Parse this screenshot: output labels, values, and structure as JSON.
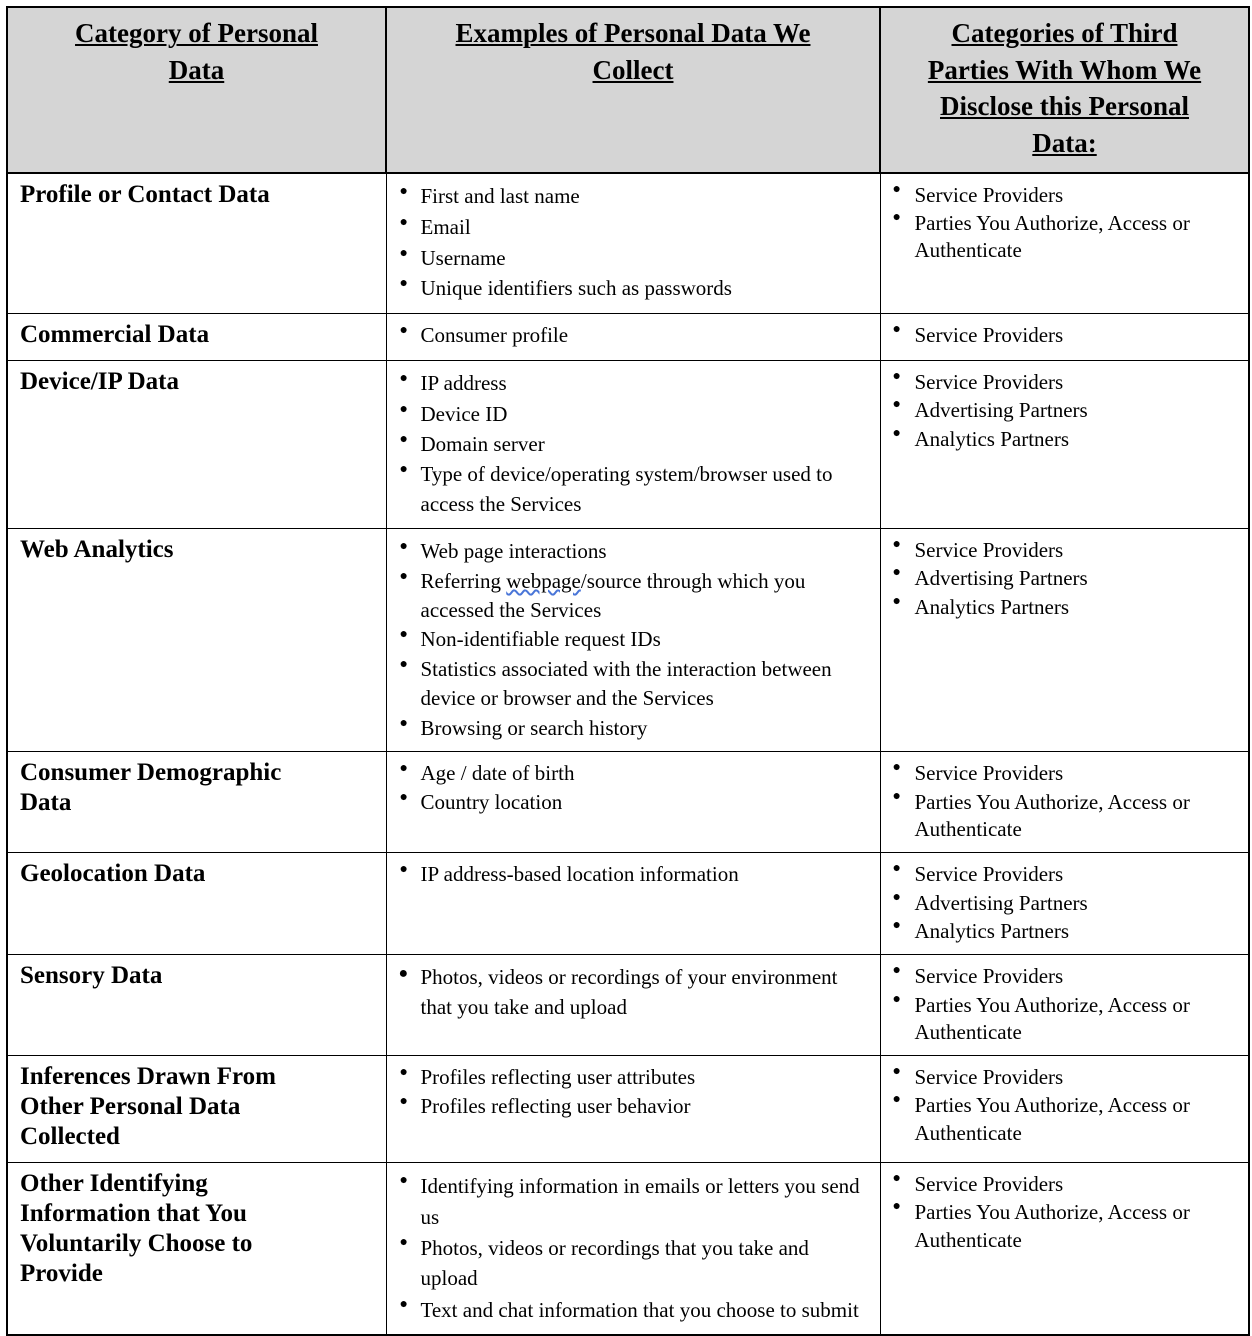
{
  "document": {
    "type": "privacy-policy-data-table",
    "header_background": "#d5d5d5",
    "border_color": "#000000",
    "spellcheck_underline_color": "#4a76d8"
  },
  "table": {
    "headers": [
      {
        "lines": [
          "Category of Personal",
          "Data"
        ]
      },
      {
        "lines": [
          "Examples of Personal Data We",
          "Collect"
        ]
      },
      {
        "lines": [
          "Categories of Third",
          "Parties With Whom We",
          "Disclose this Personal",
          "Data:"
        ]
      }
    ],
    "rows": [
      {
        "category_lines": [
          "Profile or Contact Data"
        ],
        "examples": [
          "First and last name",
          "Email",
          "Username",
          "Unique identifiers such as passwords"
        ],
        "third_parties": [
          "Service Providers",
          "Parties You Authorize, Access or Authenticate"
        ]
      },
      {
        "category_lines": [
          "Commercial Data"
        ],
        "examples": [
          "Consumer profile"
        ],
        "third_parties": [
          "Service Providers"
        ]
      },
      {
        "category_lines": [
          "Device/IP Data"
        ],
        "examples": [
          "IP address",
          "Device ID",
          "Domain server",
          "Type of device/operating system/browser used to access the Services"
        ],
        "third_parties": [
          "Service Providers",
          "Advertising Partners",
          "Analytics Partners"
        ]
      },
      {
        "category_lines": [
          "Web Analytics"
        ],
        "examples": [
          "Web page interactions",
          "Referring webpage/source through which you accessed the Services",
          "Non-identifiable request IDs",
          "Statistics associated with the interaction between device or browser and the Services",
          "Browsing or search history"
        ],
        "examples_spellcheck_word": "webpage",
        "third_parties": [
          "Service Providers",
          "Advertising Partners",
          "Analytics Partners"
        ]
      },
      {
        "category_lines": [
          "Consumer Demographic",
          "Data"
        ],
        "examples": [
          "Age / date of birth",
          "Country location"
        ],
        "third_parties": [
          "Service Providers",
          "Parties You Authorize, Access or Authenticate"
        ]
      },
      {
        "category_lines": [
          "Geolocation Data"
        ],
        "examples": [
          "IP address-based location information"
        ],
        "third_parties": [
          "Service Providers",
          "Advertising Partners",
          "Analytics Partners"
        ]
      },
      {
        "category_lines": [
          "Sensory Data"
        ],
        "examples": [
          "Photos, videos or recordings of your environment that you take and upload"
        ],
        "third_parties": [
          "Service Providers",
          "Parties You Authorize, Access or Authenticate"
        ]
      },
      {
        "category_lines": [
          "Inferences Drawn From",
          "Other Personal Data",
          "Collected"
        ],
        "examples": [
          "Profiles reflecting user attributes",
          "Profiles reflecting user behavior"
        ],
        "third_parties": [
          "Service Providers",
          "Parties You Authorize, Access or Authenticate"
        ]
      },
      {
        "category_lines": [
          "Other Identifying",
          "Information that You",
          "Voluntarily Choose to",
          "Provide"
        ],
        "examples": [
          "Identifying information in emails or letters you send us",
          "Photos, videos or recordings that you take and upload",
          "Text and chat information that you choose to submit"
        ],
        "third_parties": [
          "Service Providers",
          "Parties You Authorize, Access or Authenticate"
        ]
      }
    ]
  }
}
